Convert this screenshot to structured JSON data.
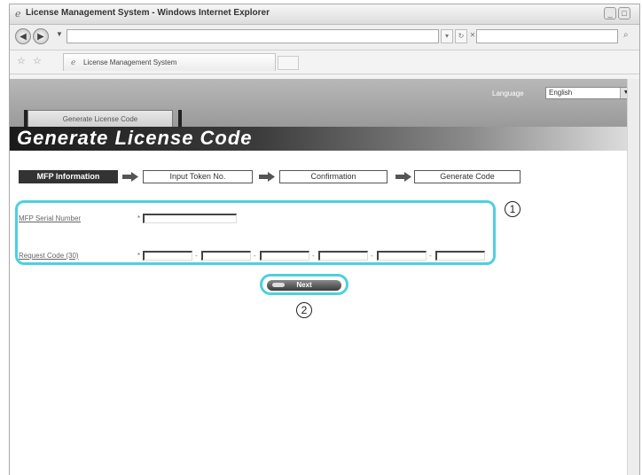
{
  "window": {
    "title": "License Management System - Windows Internet Explorer",
    "tab_title": "License Management System"
  },
  "page": {
    "language_label": "Language",
    "language_value": "English",
    "header_tab": "Generate License Code",
    "title": "Generate License Code"
  },
  "steps": [
    "MFP Information",
    "Input Token No.",
    "Confirmation",
    "Generate Code"
  ],
  "form": {
    "serial_label": "MFP Serial Number",
    "request_label": "Request Code (30)",
    "required_mark": "*",
    "dash": "-"
  },
  "buttons": {
    "next": "Next"
  },
  "callouts": [
    "1",
    "2"
  ]
}
